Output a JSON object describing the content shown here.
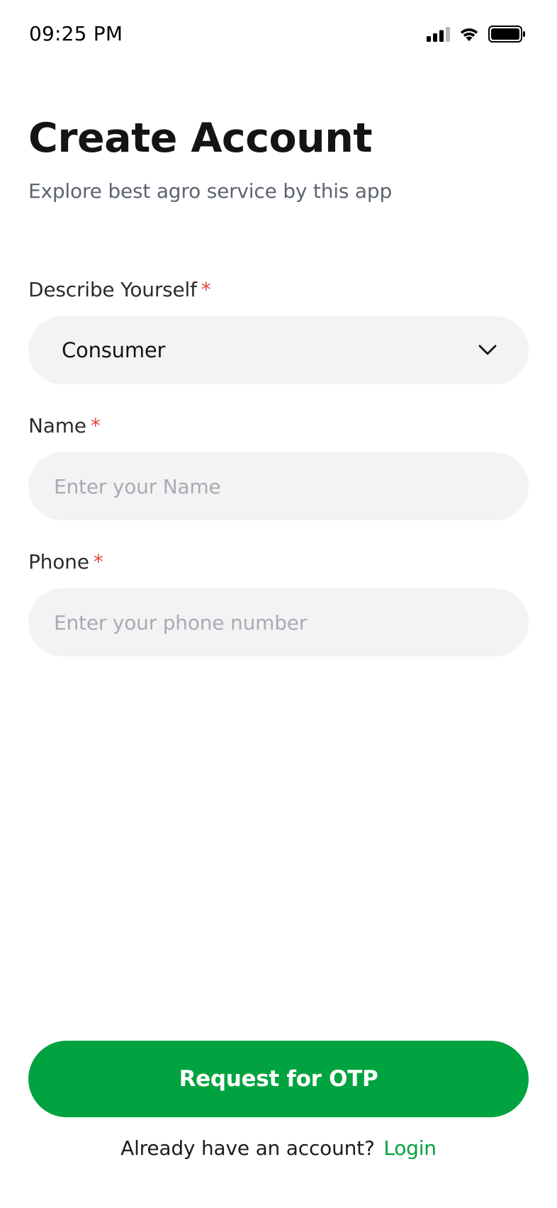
{
  "status_bar": {
    "time": "09:25 PM",
    "icons": [
      "cellular-signal-icon",
      "wifi-icon",
      "battery-icon"
    ]
  },
  "header": {
    "title": "Create Account",
    "subtitle": "Explore best agro service by this app"
  },
  "form": {
    "describe": {
      "label": "Describe Yourself",
      "required_mark": "*",
      "value": "Consumer"
    },
    "name": {
      "label": "Name",
      "required_mark": "*",
      "value": "",
      "placeholder": "Enter your Name"
    },
    "phone": {
      "label": "Phone",
      "required_mark": "*",
      "value": "",
      "placeholder": "Enter your phone number"
    }
  },
  "actions": {
    "request_otp_label": "Request for OTP",
    "login_prompt": "Already have an account?",
    "login_link": "Login"
  },
  "colors": {
    "accent": "#00a33f",
    "required": "#e0443e",
    "field_bg": "#f3f3f4",
    "placeholder": "#a6abb4"
  }
}
